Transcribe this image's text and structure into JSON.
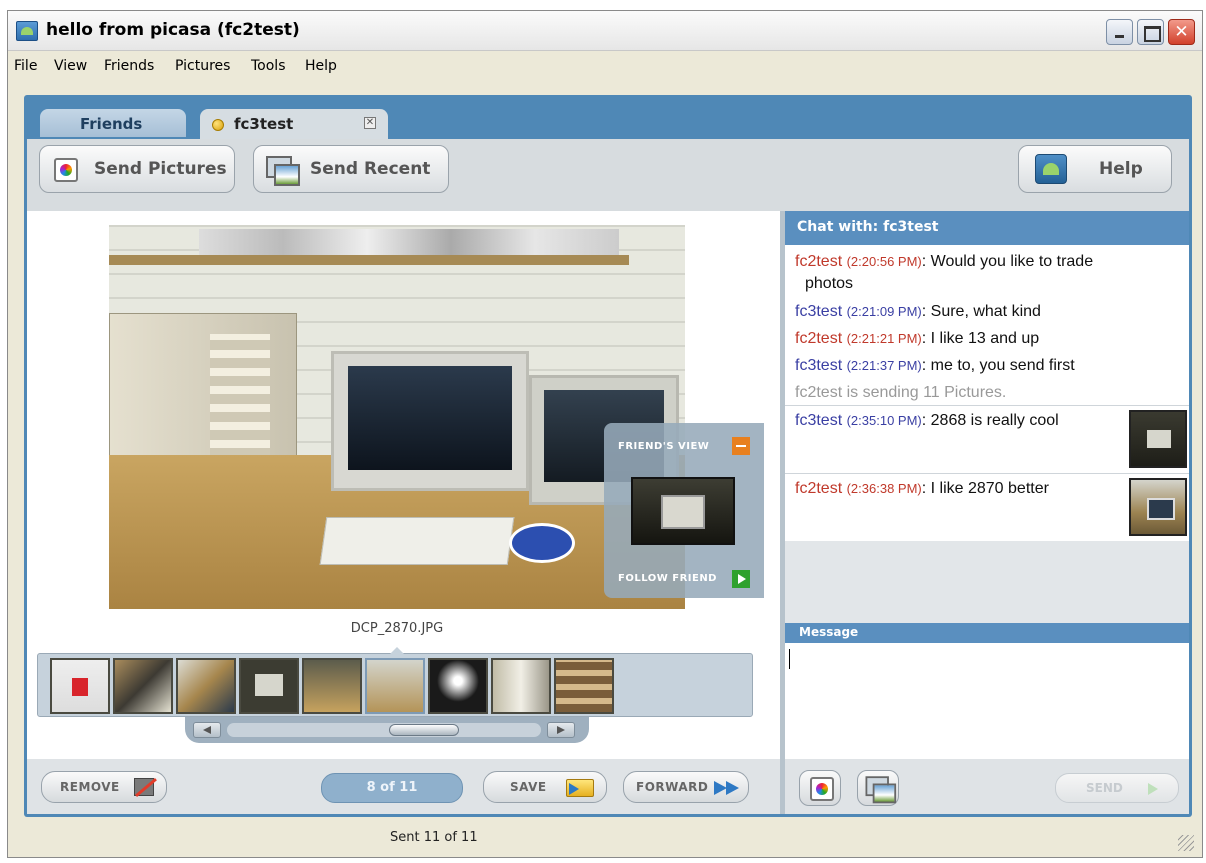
{
  "window": {
    "title": "hello from picasa (fc2test)",
    "close_glyph": "✕"
  },
  "menu": [
    "File",
    "View",
    "Friends",
    "Pictures",
    "Tools",
    "Help"
  ],
  "tabs": {
    "friends": "Friends",
    "active": "fc3test",
    "active_close": "✕"
  },
  "toolbar": {
    "send_pictures": "Send Pictures",
    "send_recent": "Send Recent",
    "help": "Help"
  },
  "viewer": {
    "friends_view_label": "FRIEND'S VIEW",
    "follow_friend_label": "FOLLOW FRIEND",
    "filename": "DCP_2870.JPG",
    "thumbnail_count": 9,
    "selected_thumbnail": 5
  },
  "actions": {
    "remove": "REMOVE",
    "counter": "8 of 11",
    "save": "SAVE",
    "forward": "FORWARD"
  },
  "chat": {
    "header": "Chat with: fc3test",
    "messages": [
      {
        "sender": "fc2test",
        "time": "(2:20:56 PM)",
        "text": "Would you like to trade",
        "cont": "photos"
      },
      {
        "sender": "fc3test",
        "time": "(2:21:09 PM)",
        "text": "Sure, what kind"
      },
      {
        "sender": "fc2test",
        "time": "(2:21:21 PM)",
        "text": "I like 13 and up"
      },
      {
        "sender": "fc3test",
        "time": "(2:21:37 PM)",
        "text": "me to, you send first"
      },
      {
        "system": "fc2test is sending 11 Pictures."
      },
      {
        "sender": "fc3test",
        "time": "(2:35:10 PM)",
        "text": "2868 is really cool"
      },
      {
        "sender": "fc2test",
        "time": "(2:36:38 PM)",
        "text": "I like 2870 better"
      }
    ],
    "message_header": "Message",
    "message_value": "",
    "send": "SEND"
  },
  "status": {
    "text": "Sent 11 of 11"
  },
  "colors": {
    "frame_blue": "#4f88b6",
    "chat_header": "#5a8fbf",
    "sender_red": "#c0392b",
    "sender_blue": "#3a3fa3",
    "counter_pill": "#8fb0cc"
  },
  "icons": [
    "picasa-app-icon",
    "send-pictures-icon",
    "send-recent-icon",
    "help-icon",
    "remove-icon",
    "save-icon",
    "forward-icon"
  ]
}
